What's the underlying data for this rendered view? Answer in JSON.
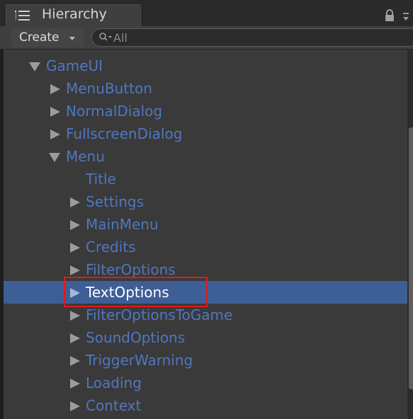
{
  "window": {
    "title": "Hierarchy"
  },
  "toolbar": {
    "create_label": "Create"
  },
  "search": {
    "placeholder": "All",
    "value": ""
  },
  "tree": [
    {
      "label": "GameUI",
      "expanded": true,
      "depth": 0
    },
    {
      "label": "MenuButton",
      "expanded": false,
      "depth": 1
    },
    {
      "label": "NormalDialog",
      "expanded": false,
      "depth": 1
    },
    {
      "label": "FullscreenDialog",
      "expanded": false,
      "depth": 1
    },
    {
      "label": "Menu",
      "expanded": true,
      "depth": 1
    },
    {
      "label": "Title",
      "leaf": true,
      "depth": 2
    },
    {
      "label": "Settings",
      "expanded": false,
      "depth": 2
    },
    {
      "label": "MainMenu",
      "expanded": false,
      "depth": 2
    },
    {
      "label": "Credits",
      "expanded": false,
      "depth": 2
    },
    {
      "label": "FilterOptions",
      "expanded": false,
      "depth": 2
    },
    {
      "label": "TextOptions",
      "expanded": false,
      "depth": 2,
      "selected": true
    },
    {
      "label": "FilterOptionsToGame",
      "expanded": false,
      "depth": 2
    },
    {
      "label": "SoundOptions",
      "expanded": false,
      "depth": 2
    },
    {
      "label": "TriggerWarning",
      "expanded": false,
      "depth": 2
    },
    {
      "label": "Loading",
      "expanded": false,
      "depth": 2
    },
    {
      "label": "Context",
      "expanded": false,
      "depth": 2
    }
  ],
  "icons": {
    "tab": "list-icon",
    "lock": "lock-icon",
    "menu": "context-menu-icon",
    "search": "search-icon"
  },
  "colors": {
    "item_text": "#4f77c2",
    "selected_bg": "#3e5e96",
    "highlight_box": "#e0191b"
  }
}
